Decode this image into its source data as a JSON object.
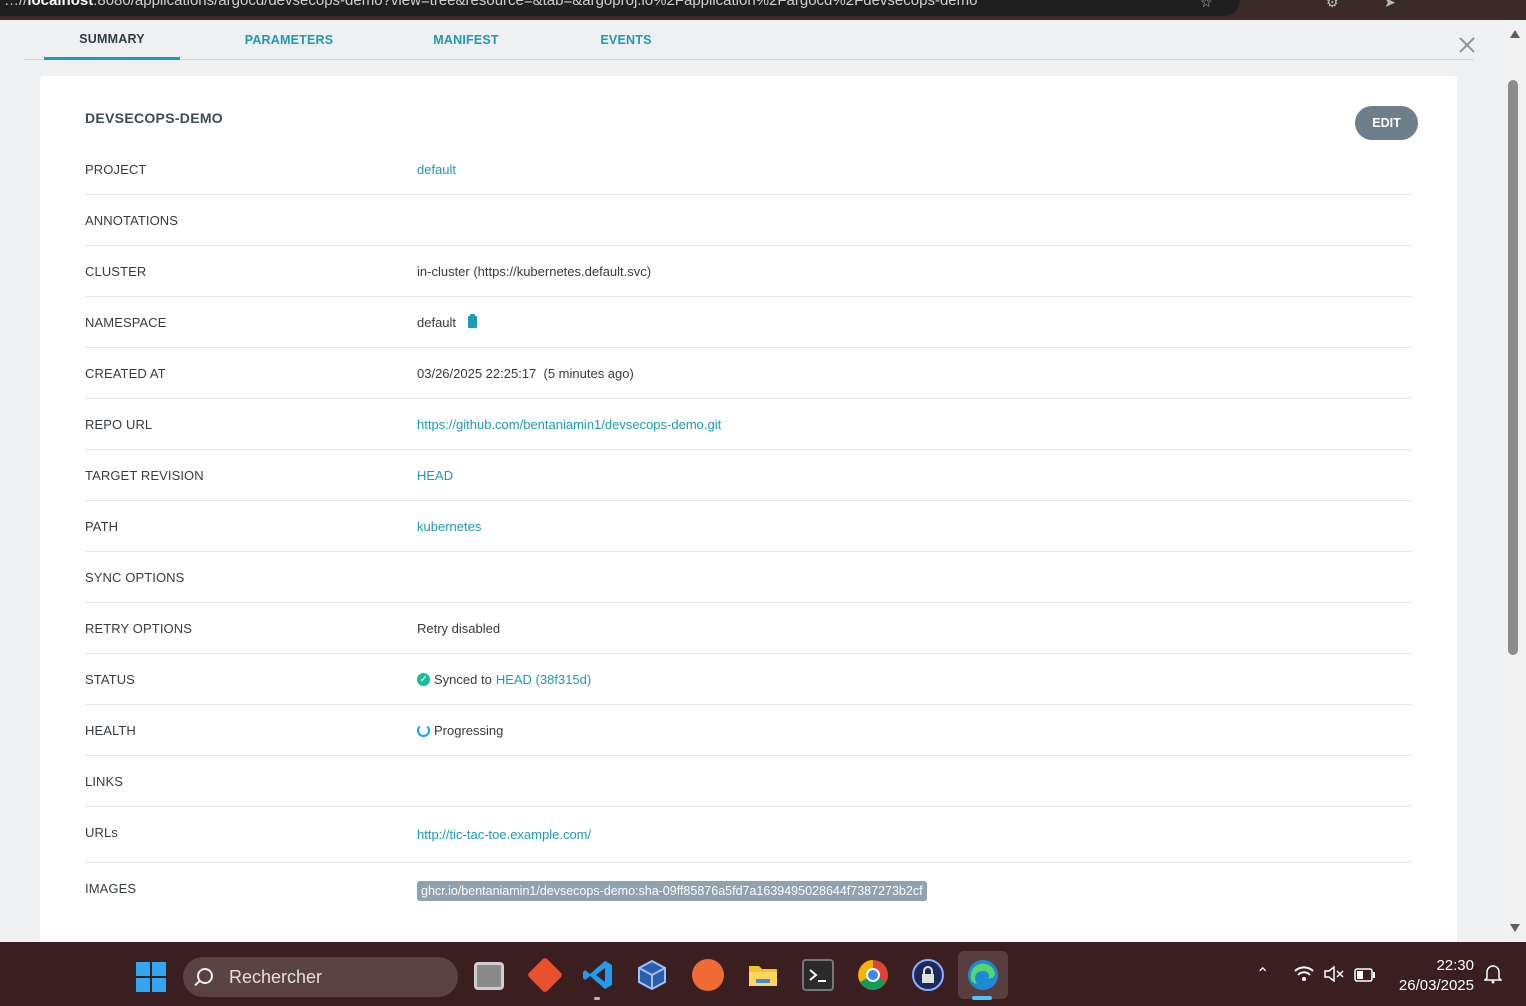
{
  "browser": {
    "url_prefix": "…//",
    "url_host": "localhost",
    "url_rest": ":8080/applications/argocd/devsecops-demo?view=tree&resource=&tab=&argoproj.io%2Fapplication%2Fargocd%2Fdevsecops-demo"
  },
  "tabs": [
    {
      "label": "SUMMARY",
      "active": true
    },
    {
      "label": "PARAMETERS"
    },
    {
      "label": "MANIFEST"
    },
    {
      "label": "EVENTS"
    }
  ],
  "summary": {
    "title": "DEVSECOPS-DEMO",
    "edit_label": "EDIT",
    "rows": {
      "project": {
        "label": "PROJECT",
        "value": "default"
      },
      "annotations": {
        "label": "ANNOTATIONS",
        "value": ""
      },
      "cluster": {
        "label": "CLUSTER",
        "value": "in-cluster (https://kubernetes.default.svc)"
      },
      "namespace": {
        "label": "NAMESPACE",
        "value": "default"
      },
      "created_at": {
        "label": "CREATED AT",
        "value": "03/26/2025 22:25:17  (5 minutes ago)"
      },
      "repo_url": {
        "label": "REPO URL",
        "value": "https://github.com/bentaniamin1/devsecops-demo.git"
      },
      "target_revision": {
        "label": "TARGET REVISION",
        "value": "HEAD"
      },
      "path": {
        "label": "PATH",
        "value": "kubernetes"
      },
      "sync_options": {
        "label": "SYNC OPTIONS",
        "value": ""
      },
      "retry_options": {
        "label": "RETRY OPTIONS",
        "value": "Retry disabled"
      },
      "status": {
        "label": "STATUS",
        "text": "Synced to",
        "revision": "HEAD (38f315d)"
      },
      "health": {
        "label": "HEALTH",
        "value": "Progressing"
      },
      "links": {
        "label": "LINKS",
        "value": ""
      },
      "urls": {
        "label": "URLs",
        "value": "http://tic-tac-toe.example.com/"
      },
      "images": {
        "label": "IMAGES",
        "value": "ghcr.io/bentaniamin1/devsecops-demo:sha-09ff85876a5fd7a1639495028644f7387273b2cf"
      }
    }
  },
  "taskbar": {
    "search_placeholder": "Rechercher",
    "time": "22:30",
    "date": "26/03/2025",
    "apps": [
      "task-view",
      "git-tool",
      "vscode",
      "virtualbox",
      "postman",
      "file-explorer",
      "terminal",
      "chrome",
      "vpn-lock",
      "edge"
    ]
  },
  "colors": {
    "accent": "#1d9bb5",
    "edit_button": "#6d7f8b",
    "synced_green": "#18be94",
    "progressing_blue": "#0dadea",
    "taskbar": "#3b1f20"
  }
}
